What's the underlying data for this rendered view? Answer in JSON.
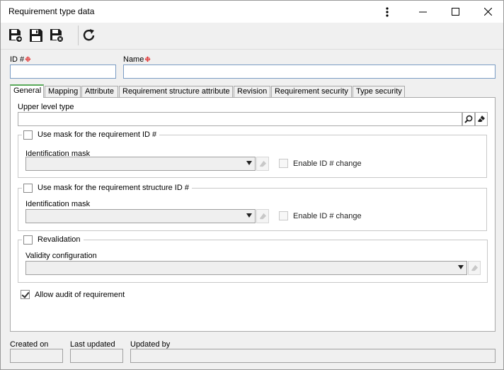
{
  "window": {
    "title": "Requirement type data",
    "menu_icon": "vertical-ellipsis-icon",
    "minimize_icon": "minimize-icon",
    "maximize_icon": "maximize-icon",
    "close_icon": "close-icon"
  },
  "toolbar": {
    "buttons": [
      "save-and-new-icon",
      "save-icon",
      "save-and-close-icon",
      "refresh-icon"
    ]
  },
  "form": {
    "id_label": "ID #",
    "id_value": "",
    "name_label": "Name",
    "name_value": "",
    "required_mark": "❉"
  },
  "tabs": [
    {
      "label": "General",
      "active": true
    },
    {
      "label": "Mapping",
      "active": false
    },
    {
      "label": "Attribute",
      "active": false
    },
    {
      "label": "Requirement structure attribute",
      "active": false
    },
    {
      "label": "Revision",
      "active": false
    },
    {
      "label": "Requirement security",
      "active": false
    },
    {
      "label": "Type security",
      "active": false
    }
  ],
  "general": {
    "upper_level_label": "Upper level type",
    "upper_level_value": "",
    "mask_group": {
      "caption": "Use mask for the requirement ID #",
      "checked": false,
      "mask_label": "Identification mask",
      "mask_value": "",
      "enable_change_label": "Enable ID # change",
      "enable_change_checked": false
    },
    "structure_mask_group": {
      "caption": "Use mask for the requirement structure ID #",
      "checked": false,
      "mask_label": "Identification mask",
      "mask_value": "",
      "enable_change_label": "Enable ID # change",
      "enable_change_checked": false
    },
    "revalidation_group": {
      "caption": "Revalidation",
      "checked": false,
      "validity_label": "Validity configuration",
      "validity_value": ""
    },
    "audit_label": "Allow audit of requirement",
    "audit_checked": true
  },
  "footer": {
    "created_on_label": "Created on",
    "created_on_value": "",
    "last_updated_label": "Last updated",
    "last_updated_value": "",
    "updated_by_label": "Updated by",
    "updated_by_value": ""
  },
  "colors": {
    "active_tab_accent": "#5aaa5a",
    "required_mark": "#dd0000",
    "input_border": "#7a9cc4"
  }
}
